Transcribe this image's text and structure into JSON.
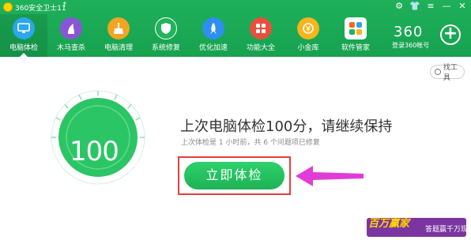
{
  "titlebar": {
    "title": "360安全卫士11",
    "up_arrow": "↑"
  },
  "window_controls": [
    "⚙",
    "👕",
    "≡",
    "—",
    "✕"
  ],
  "tabs": [
    {
      "label": "电脑体检",
      "icon": "monitor-icon",
      "color": "#2ba7ea",
      "active": true
    },
    {
      "label": "木马查杀",
      "icon": "horse-icon",
      "color": "#8a55d6",
      "active": false
    },
    {
      "label": "电脑清理",
      "icon": "broom-icon",
      "color": "#f3a521",
      "active": false
    },
    {
      "label": "系统修复",
      "icon": "shield-icon",
      "color": "#21b45c",
      "active": false
    },
    {
      "label": "优化加速",
      "icon": "rocket-icon",
      "color": "#2f8ef0",
      "active": false
    },
    {
      "label": "功能大全",
      "icon": "grid-icon",
      "color": "#ea4f3c",
      "active": false
    },
    {
      "label": "小金库",
      "icon": "coin-icon",
      "color": "#f6b51b",
      "active": false
    },
    {
      "label": "软件管家",
      "icon": "apps-icon",
      "color": "#ef6a1c",
      "active": false
    }
  ],
  "brand": {
    "logo_text": "360",
    "login_text": "登录360帐号"
  },
  "toolbox": {
    "label": "找工具"
  },
  "score": {
    "value": "100",
    "unit": "分"
  },
  "result": {
    "title": "上次电脑体检100分，请继续保持",
    "subtitle": "上次体检是 1 小时前，共 6 个问题项已修复"
  },
  "check_button": {
    "label": "立即体检"
  },
  "promo": {
    "logo": "百万赢家",
    "text": "答题赢千万现金"
  },
  "colors": {
    "header_green": "#1fb05a",
    "score_green": "#2cc565",
    "highlight_red": "#e53d3d",
    "arrow_magenta": "#e23bd8"
  }
}
